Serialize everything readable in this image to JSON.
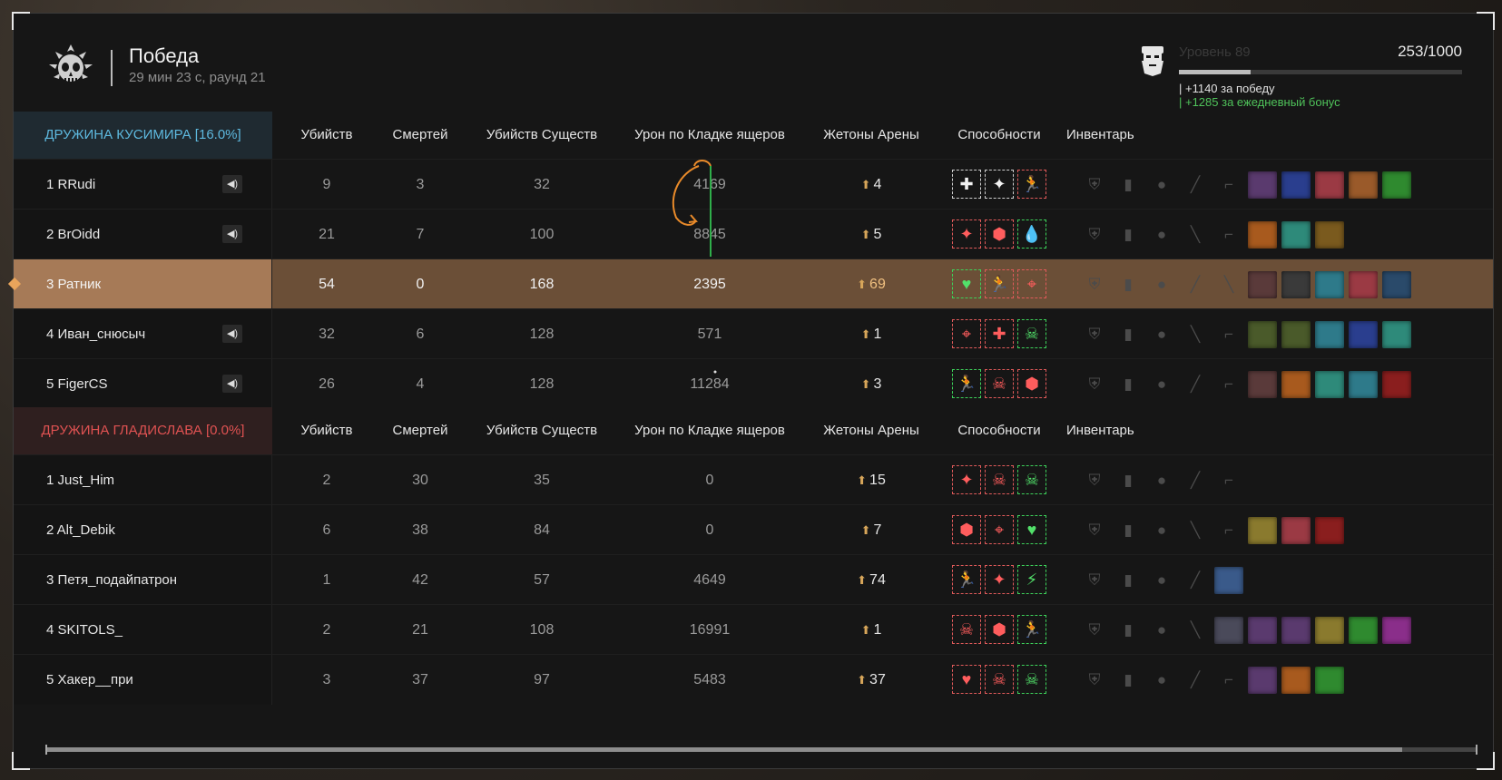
{
  "header": {
    "result": "Победа",
    "subinfo": "29 мин 23 с, раунд 21"
  },
  "xp": {
    "level_label": "Уровень 89",
    "count": "253/1000",
    "progress": 0.253,
    "line1": "| +1140 за победу",
    "line2": "| +1285 за ежедневный бонус"
  },
  "columns": {
    "kills": "Убийств",
    "deaths": "Смертей",
    "creature_kills": "Убийств Существ",
    "damage": "Урон по Кладке ящеров",
    "tokens": "Жетоны Арены",
    "abilities": "Способности",
    "inventory": "Инвентарь"
  },
  "team1": {
    "name": "ДРУЖИНА КУСИМИРА [16.0%]",
    "players": [
      {
        "name": "1 RRudi",
        "kills": "9",
        "deaths": "3",
        "creatures": "32",
        "damage": "4169",
        "tokens": "4",
        "voice": true,
        "abilities": [
          [
            "w",
            "✚"
          ],
          [
            "w",
            "✦"
          ],
          [
            "r",
            "🏃"
          ]
        ]
      },
      {
        "name": "2 BrOidd",
        "kills": "21",
        "deaths": "7",
        "creatures": "100",
        "damage": "8845",
        "tokens": "5",
        "voice": true,
        "abilities": [
          [
            "r",
            "✦"
          ],
          [
            "r",
            "⬢"
          ],
          [
            "g",
            "💧"
          ]
        ]
      },
      {
        "name": "3 Ратник",
        "kills": "54",
        "deaths": "0",
        "creatures": "168",
        "damage": "2395",
        "tokens": "69",
        "voice": false,
        "highlight": true,
        "abilities": [
          [
            "g",
            "♥"
          ],
          [
            "r",
            "🏃"
          ],
          [
            "r",
            "⌖"
          ]
        ]
      },
      {
        "name": "4 Иван_снюсыч",
        "kills": "32",
        "deaths": "6",
        "creatures": "128",
        "damage": "571",
        "tokens": "1",
        "voice": true,
        "abilities": [
          [
            "r",
            "⌖"
          ],
          [
            "r",
            "✚"
          ],
          [
            "g",
            "☠"
          ]
        ]
      },
      {
        "name": "5 FigerCS",
        "kills": "26",
        "deaths": "4",
        "creatures": "128",
        "damage": "11284",
        "tokens": "3",
        "voice": true,
        "abilities": [
          [
            "g",
            "🏃"
          ],
          [
            "r",
            "☠"
          ],
          [
            "r",
            "⬢"
          ]
        ]
      }
    ]
  },
  "team2": {
    "name": "ДРУЖИНА ГЛАДИСЛАВА [0.0%]",
    "players": [
      {
        "name": "1 Just_Him",
        "kills": "2",
        "deaths": "30",
        "creatures": "35",
        "damage": "0",
        "tokens": "15",
        "abilities": [
          [
            "r",
            "✦"
          ],
          [
            "r",
            "☠"
          ],
          [
            "g",
            "☠"
          ]
        ]
      },
      {
        "name": "2 Alt_Debik",
        "kills": "6",
        "deaths": "38",
        "creatures": "84",
        "damage": "0",
        "tokens": "7",
        "abilities": [
          [
            "r",
            "⬢"
          ],
          [
            "r",
            "⌖"
          ],
          [
            "g",
            "♥"
          ]
        ]
      },
      {
        "name": "3 Петя_подайпатрон",
        "kills": "1",
        "deaths": "42",
        "creatures": "57",
        "damage": "4649",
        "tokens": "74",
        "abilities": [
          [
            "r",
            "🏃"
          ],
          [
            "r",
            "✦"
          ],
          [
            "g",
            "⚡"
          ]
        ]
      },
      {
        "name": "4 SKITOLS_",
        "kills": "2",
        "deaths": "21",
        "creatures": "108",
        "damage": "16991",
        "tokens": "1",
        "abilities": [
          [
            "r",
            "☠"
          ],
          [
            "r",
            "⬢"
          ],
          [
            "g",
            "🏃"
          ]
        ]
      },
      {
        "name": "5 Хакер__при",
        "kills": "3",
        "deaths": "37",
        "creatures": "97",
        "damage": "5483",
        "tokens": "37",
        "abilities": [
          [
            "r",
            "♥"
          ],
          [
            "r",
            "☠"
          ],
          [
            "g",
            "☠"
          ]
        ]
      }
    ]
  },
  "inventory": {
    "team1": [
      [
        "armor",
        "pack",
        "grenade",
        "knife",
        "gun",
        "#5a3a6e",
        "#2a3e8e",
        "#9b3a44",
        "#9a5a2a",
        "#2f8a2f"
      ],
      [
        "armor",
        "pack",
        "grenade",
        "rifle",
        "gun",
        "#a85a1e",
        "#2e8a7a",
        "#7a5a1e"
      ],
      [
        "armor",
        "pack",
        "grenade",
        "knife",
        "rifle",
        "#5a3a3a",
        "#3a3a3a",
        "#2e7a8a",
        "#9b3a44",
        "#2a4a6a"
      ],
      [
        "armor",
        "pack",
        "grenade",
        "rifle",
        "gun",
        "#4a5a2a",
        "#4a5a2a",
        "#2e7a8a",
        "#2a3e8e",
        "#2e8a7a"
      ],
      [
        "armor",
        "pack",
        "grenade",
        "knife",
        "gun",
        "#5a3a3a",
        "#a85a1e",
        "#2e8a7a",
        "#2e7a8a",
        "#8a1e1e"
      ]
    ],
    "team2": [
      [
        "armor",
        "pack",
        "grenade",
        "knife",
        "gun"
      ],
      [
        "armor",
        "pack",
        "grenade",
        "rifle",
        "gun",
        "#8a7a2e",
        "#9b3a44",
        "#8a1e1e"
      ],
      [
        "armor",
        "pack",
        "grenade",
        "knife",
        "#3a5a8a"
      ],
      [
        "armor",
        "pack",
        "grenade",
        "rifle",
        "#4a4a5a",
        "#5a3a6e",
        "#5a3a6e",
        "#8a7a2e",
        "#2f8a2f",
        "#8a2e8a"
      ],
      [
        "armor",
        "pack",
        "grenade",
        "knife",
        "gun",
        "#5a3a6e",
        "#a85a1e",
        "#2f8a2f"
      ]
    ]
  },
  "colors": {
    "team1": "#5eb9df",
    "team2": "#e05252",
    "highlight": "#a67a57",
    "bonus": "#4fc25a"
  }
}
